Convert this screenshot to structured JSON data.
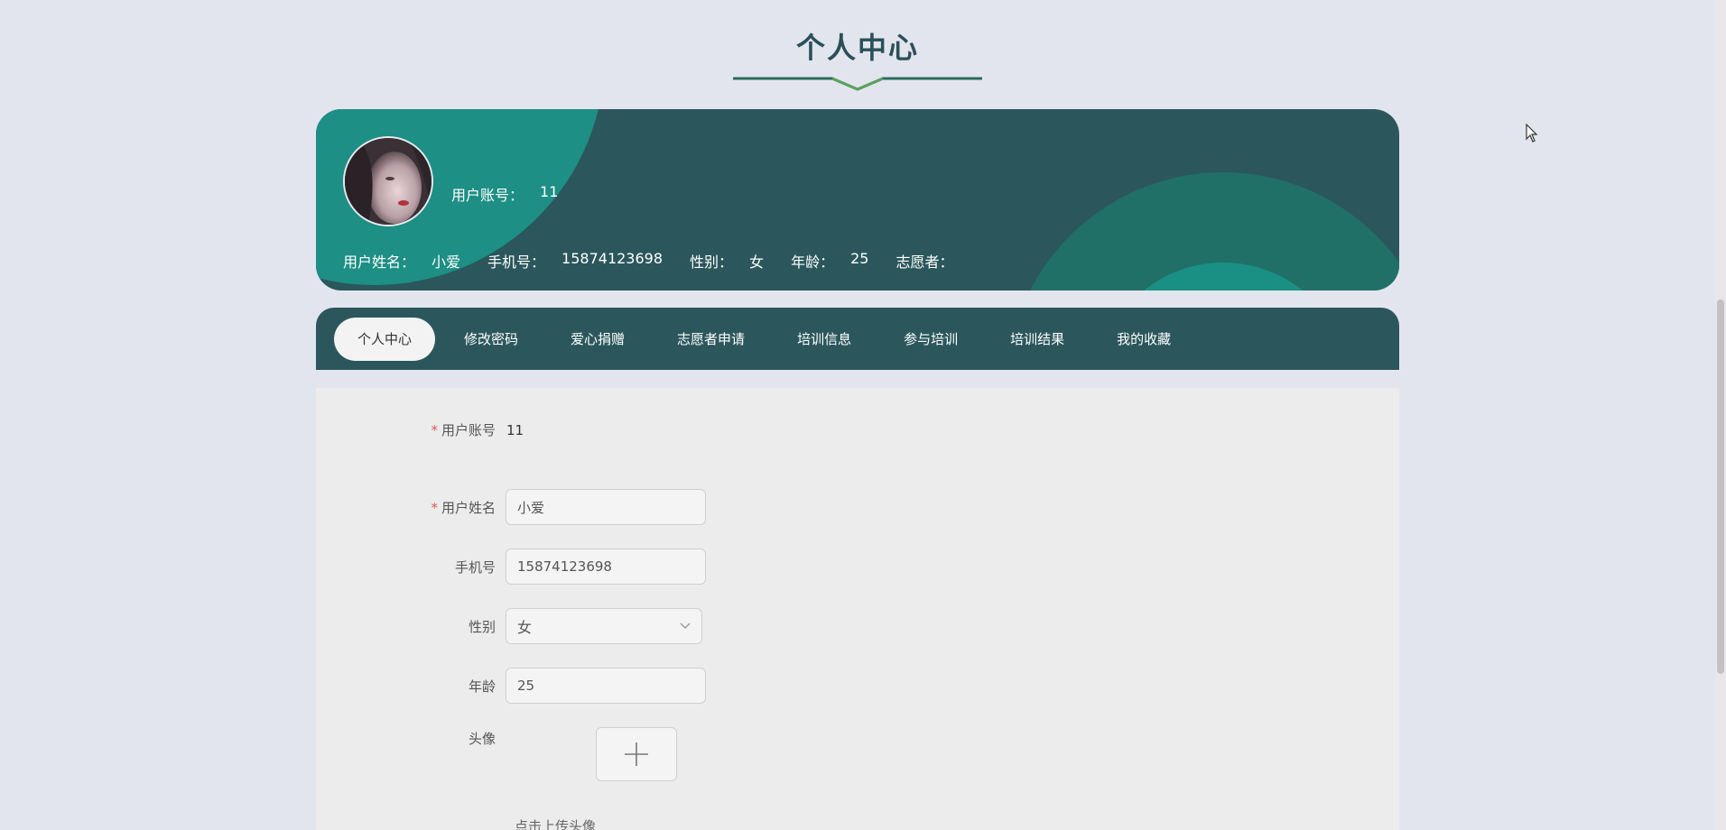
{
  "header": {
    "title": "个人中心"
  },
  "profile": {
    "account_label": "用户账号：",
    "account_value": "11",
    "name_label": "用户姓名：",
    "name_value": "小爱",
    "phone_label": "手机号：",
    "phone_value": "15874123698",
    "gender_label": "性别：",
    "gender_value": "女",
    "age_label": "年龄：",
    "age_value": "25",
    "volunteer_label": "志愿者：",
    "volunteer_value": ""
  },
  "tabs": [
    {
      "label": "个人中心",
      "active": true
    },
    {
      "label": "修改密码"
    },
    {
      "label": "爱心捐赠"
    },
    {
      "label": "志愿者申请"
    },
    {
      "label": "培训信息"
    },
    {
      "label": "参与培训"
    },
    {
      "label": "培训结果"
    },
    {
      "label": "我的收藏"
    }
  ],
  "form": {
    "account_label": "用户账号",
    "account_value": "11",
    "name_label": "用户姓名",
    "name_value": "小爱",
    "phone_label": "手机号",
    "phone_value": "15874123698",
    "gender_label": "性别",
    "gender_value": "女",
    "age_label": "年龄",
    "age_value": "25",
    "avatar_label": "头像",
    "upload_hint": "点击上传头像",
    "required_mark": "*"
  },
  "colors": {
    "banner": "#2b575c",
    "accent_teal": "#1d8f84",
    "page_bg": "#e3e5ee"
  }
}
